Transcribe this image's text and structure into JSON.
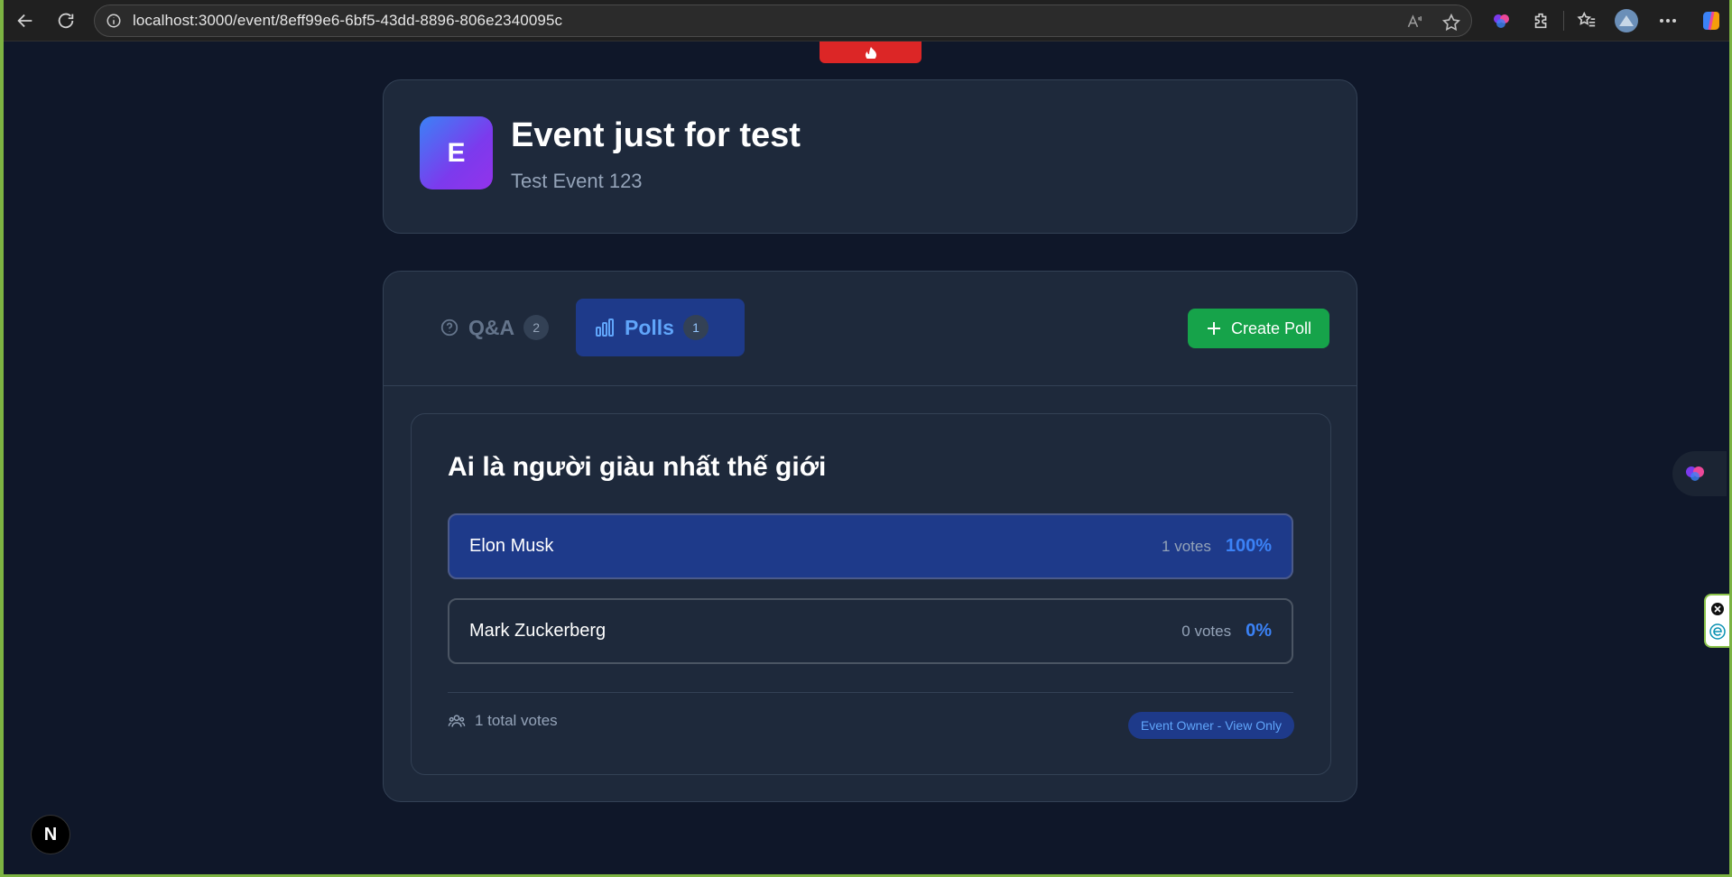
{
  "browser": {
    "url": "localhost:3000/event/8eff99e6-6bf5-43dd-8896-806e2340095c"
  },
  "event": {
    "avatar_letter": "E",
    "title": "Event just for test",
    "subtitle": "Test Event 123"
  },
  "tabs": [
    {
      "label": "Q&A",
      "count": "2",
      "active": false
    },
    {
      "label": "Polls",
      "count": "1",
      "active": true
    }
  ],
  "create_poll_label": "Create Poll",
  "poll": {
    "question": "Ai là người giàu nhất thế giới",
    "options": [
      {
        "name": "Elon Musk",
        "votes": "1 votes",
        "percent": "100%"
      },
      {
        "name": "Mark Zuckerberg",
        "votes": "0 votes",
        "percent": "0%"
      }
    ],
    "total_votes": "1 total votes",
    "owner_badge": "Event Owner - View Only"
  },
  "next_badge": "N",
  "colors": {
    "background": "#0f1729",
    "card": "#1e293b",
    "accent_blue": "#3b82f6",
    "active_tab": "#1e3a8a",
    "create_button": "#16a34a",
    "red_tab": "#dc2626"
  }
}
